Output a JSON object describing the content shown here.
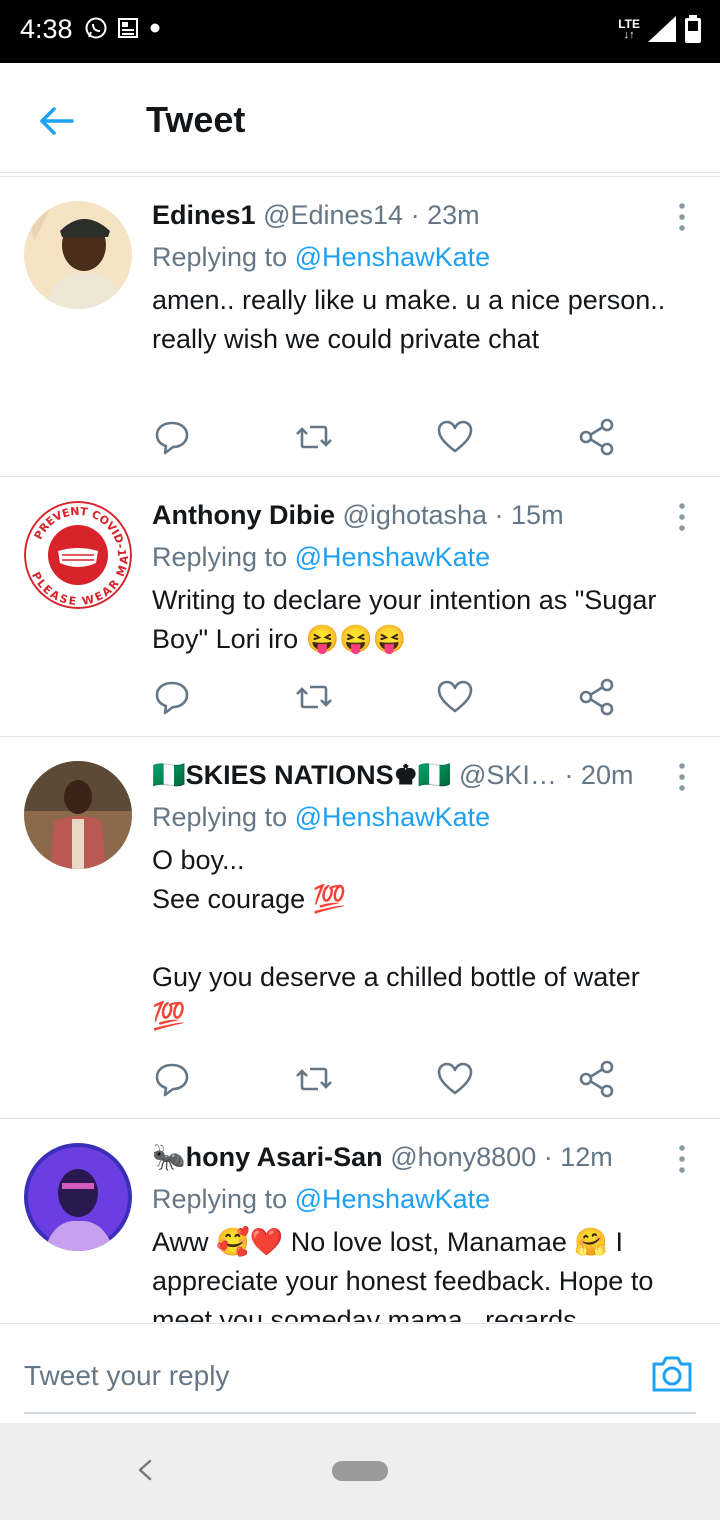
{
  "status_bar": {
    "time": "4:38",
    "network": "LTE",
    "icons": [
      "whatsapp-icon",
      "news-icon",
      "notification-dot-icon",
      "signal-icon",
      "battery-icon"
    ]
  },
  "header": {
    "title": "Tweet",
    "back_icon": "back-arrow-icon"
  },
  "tweets": [
    {
      "name": "Edines1",
      "handle": "@Edines14",
      "time": "· 23m",
      "replying_prefix": "Replying to",
      "replying_handle": "@HenshawKate",
      "body": "amen.. really like u make. u a nice person.. really wish we could private chat"
    },
    {
      "name": "Anthony Dibie",
      "handle": "@ighotasha",
      "time": "· 15m",
      "replying_prefix": "Replying to",
      "replying_handle": "@HenshawKate",
      "body": "Writing to declare your intention as \"Sugar Boy\" Lori iro 😝😝😝",
      "avatar_text": {
        "top": "PREVENT COVID-19",
        "bottom": "PLEASE WEAR MASK"
      }
    },
    {
      "name": "🇳🇬SKIES NATIONS♚🇳🇬",
      "handle": "@SKI…",
      "time": "· 20m",
      "replying_prefix": "Replying to",
      "replying_handle": "@HenshawKate",
      "body": "O boy...\nSee courage 💯\n\nGuy you deserve a chilled bottle of water\n💯"
    },
    {
      "name": "🐜hony Asari-San",
      "handle": "@hony8800",
      "time": "· 12m",
      "replying_prefix": "Replying to",
      "replying_handle": "@HenshawKate",
      "body": "Aww 🥰❤️ No love lost, Manamae 🤗 I appreciate your honest feedback. Hope to meet you someday mama.. regards"
    }
  ],
  "composer": {
    "placeholder": "Tweet your reply",
    "camera_icon": "camera-icon"
  },
  "colors": {
    "accent": "#1da1f2",
    "secondary_text": "#657786",
    "primary_text": "#14171a"
  }
}
